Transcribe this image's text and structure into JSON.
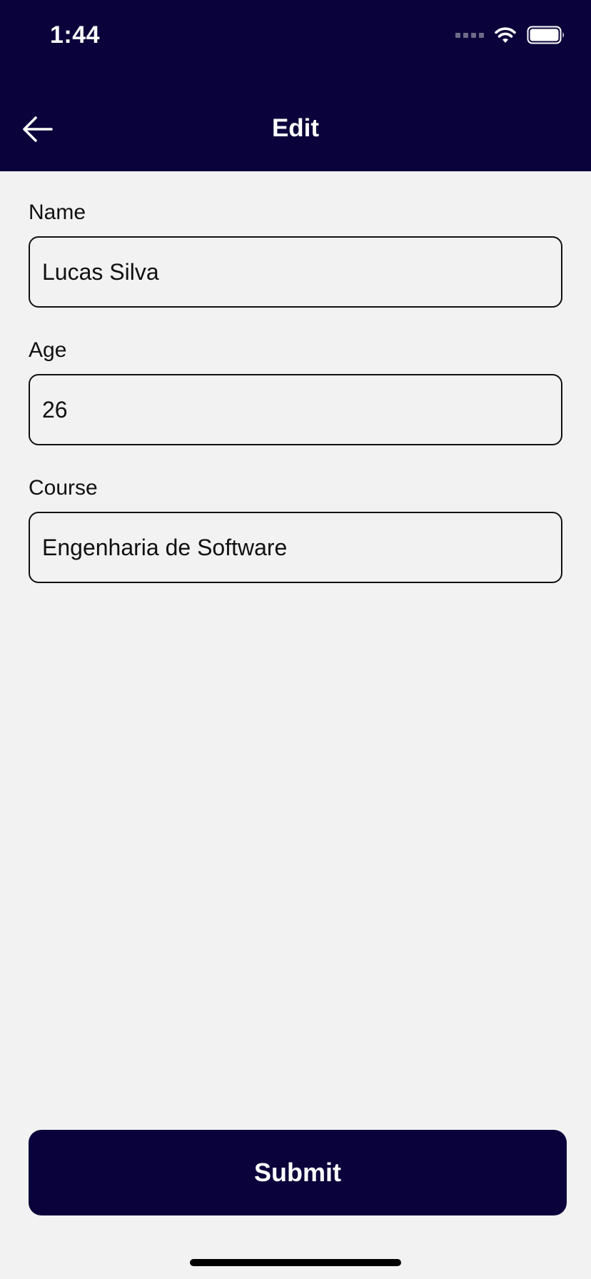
{
  "status_bar": {
    "time": "1:44"
  },
  "header": {
    "title": "Edit",
    "back_icon": "arrow-left-icon"
  },
  "form": {
    "fields": [
      {
        "label": "Name",
        "value": "Lucas Silva"
      },
      {
        "label": "Age",
        "value": "26"
      },
      {
        "label": "Course",
        "value": "Engenharia de Software"
      }
    ]
  },
  "actions": {
    "submit_label": "Submit"
  },
  "colors": {
    "header_bg": "#0a033b",
    "page_bg": "#f2f2f2",
    "button_bg": "#0a033b",
    "text": "#111111",
    "on_dark_text": "#ffffff"
  }
}
